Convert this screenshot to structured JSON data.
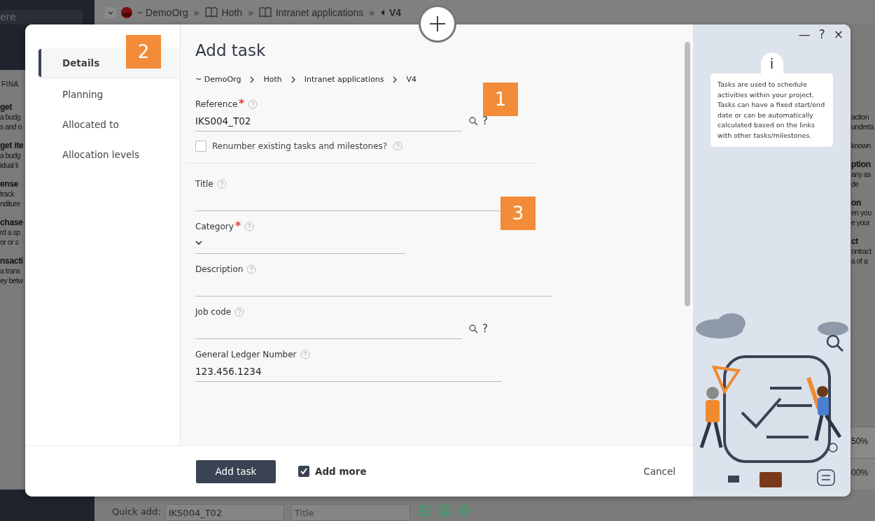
{
  "background": {
    "nav_search": "ere",
    "section_label": "FINA",
    "separator": "»",
    "breadcrumb": [
      {
        "label": "~ DemoOrg",
        "kind": "org"
      },
      {
        "label": "Hoth",
        "kind": "book"
      },
      {
        "label": "Intranet applications",
        "kind": "book"
      },
      {
        "label": "V4",
        "kind": "version"
      }
    ],
    "left_items": [
      {
        "title": "get",
        "lines": [
          "a budg",
          "s and o"
        ]
      },
      {
        "title": "get ite",
        "lines": [
          "a budg",
          "idual li"
        ]
      },
      {
        "title": "ense",
        "lines": [
          "track",
          "nditure"
        ]
      },
      {
        "title": "chase",
        "lines": [
          "rd a sp",
          "or or s"
        ]
      },
      {
        "title": "nsacti",
        "lines": [
          "a trans",
          "ey betw"
        ]
      }
    ],
    "right_items": [
      {
        "lines": [
          "action",
          "underta"
        ]
      },
      {
        "lines": [
          "known"
        ]
      },
      {
        "title": "ption",
        "lines": [
          "any as",
          "de"
        ]
      },
      {
        "title": "on",
        "lines": [
          "en you",
          "e your"
        ]
      },
      {
        "title": "ct",
        "lines": [
          "ontract",
          "a of a"
        ]
      }
    ],
    "percentages": [
      "50%",
      "00%"
    ],
    "quick_add": {
      "label": "Quick add:",
      "reference": "IKS004_T02",
      "title_placeholder": "Title"
    }
  },
  "dialog": {
    "title": "Add task",
    "window_controls": [
      "—",
      "?",
      "×"
    ],
    "nav": [
      {
        "label": "Details",
        "selected": true
      },
      {
        "label": "Planning",
        "selected": false
      },
      {
        "label": "Allocated to",
        "selected": false
      },
      {
        "label": "Allocation levels",
        "selected": false
      }
    ],
    "breadcrumb": [
      "~ DemoOrg",
      "Hoth",
      "Intranet applications",
      "V4"
    ],
    "fields": [
      {
        "kind": "lookup",
        "label": "Reference",
        "required": true,
        "value": "IKS004_T02",
        "lookup_help": "?"
      },
      {
        "kind": "checkbox",
        "label": "Renumber existing tasks and milestones?",
        "checked": false
      },
      {
        "kind": "separator"
      },
      {
        "kind": "text",
        "label": "Title",
        "required": false
      },
      {
        "kind": "select",
        "label": "Category",
        "required": true
      },
      {
        "kind": "textarea",
        "label": "Description",
        "required": false
      },
      {
        "kind": "lookup",
        "label": "Job code",
        "required": false,
        "lookup_help": "?"
      },
      {
        "kind": "text",
        "label": "General Ledger Number",
        "required": false,
        "value": "123.456.1234"
      }
    ],
    "info_icon": "i",
    "info": "Tasks are used to schedule activities within your project. Tasks can have a fixed start/end date or can be automatically calculated based on the links with other tasks/milestones.",
    "submit": "Add task",
    "add_more": {
      "label": "Add more",
      "checked": true
    },
    "cancel": "Cancel"
  },
  "callouts": [
    "1",
    "2",
    "3"
  ]
}
